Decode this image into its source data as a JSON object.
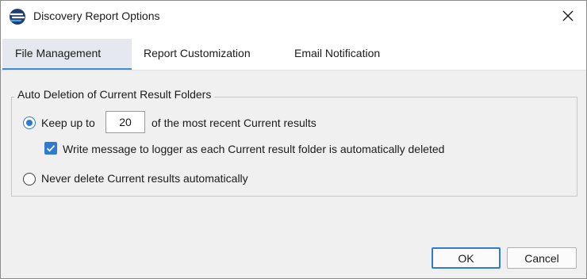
{
  "window": {
    "title": "Discovery Report Options",
    "close_icon": "close-icon",
    "app_icon": "discovery-app-icon"
  },
  "tabs": [
    {
      "label": "File Management",
      "active": true
    },
    {
      "label": "Report Customization",
      "active": false
    },
    {
      "label": "Email Notification",
      "active": false
    }
  ],
  "group": {
    "title": "Auto Deletion of Current Result Folders",
    "keep_option": {
      "label_before": "Keep up to",
      "value": "20",
      "label_after": "of the most recent Current results",
      "selected": true
    },
    "logger_checkbox": {
      "label": "Write message to logger as each Current result folder is automatically deleted",
      "checked": true
    },
    "never_option": {
      "label": "Never delete Current results automatically",
      "selected": false
    }
  },
  "buttons": {
    "ok": "OK",
    "cancel": "Cancel"
  },
  "colors": {
    "accent": "#2f7bd1",
    "tab_active_bg": "#e5e9ef",
    "window_bg": "#f0f0f0"
  }
}
